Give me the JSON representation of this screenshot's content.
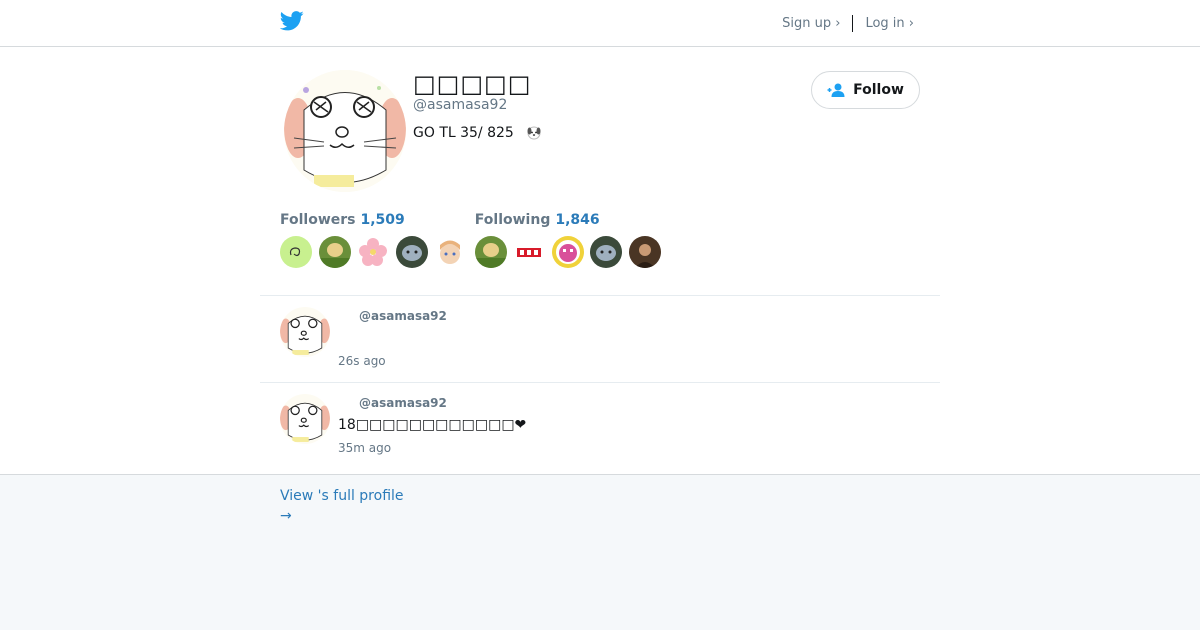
{
  "header": {
    "signup_label": "Sign up ›",
    "login_label": "Log in ›"
  },
  "profile": {
    "display_name": "□□□□□",
    "handle": "@asamasa92",
    "bio": "GO TL 35/ 825",
    "follow_label": "Follow",
    "followers_label": "Followers",
    "followers_count": "1,509",
    "following_label": "Following",
    "following_count": "1,846"
  },
  "follower_avatars": [
    {
      "icon": "green-cursive-avatar",
      "color": "#c8f08f"
    },
    {
      "icon": "dog-grass-avatar",
      "color": "#6a8f3a"
    },
    {
      "icon": "pink-flower-avatar",
      "color": "#f7c7d0"
    },
    {
      "icon": "cat-avatar",
      "color": "#3b4a3a"
    },
    {
      "icon": "anime-avatar",
      "color": "#e9b27c"
    }
  ],
  "following_avatars": [
    {
      "icon": "dog-grass-avatar",
      "color": "#6a8f3a"
    },
    {
      "icon": "red-logo-avatar",
      "color": "#ffffff"
    },
    {
      "icon": "pink-character-avatar",
      "color": "#f0d23a"
    },
    {
      "icon": "cat-avatar",
      "color": "#3b4a3a"
    },
    {
      "icon": "person-avatar",
      "color": "#4a3524"
    }
  ],
  "tweets": [
    {
      "handle": "@asamasa92",
      "text": "",
      "time": "26s ago"
    },
    {
      "handle": "@asamasa92",
      "text": "18□□□□□□□□□□□□❤",
      "time": "35m ago"
    }
  ],
  "footer": {
    "view_profile_label": "View 's full profile",
    "arrow": "→"
  },
  "colors": {
    "link": "#2b7bb9",
    "muted": "#657786",
    "twitter_blue": "#1da1f2",
    "footer_bg": "#f5f8fa"
  }
}
